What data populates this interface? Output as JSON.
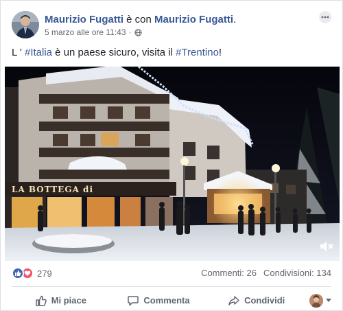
{
  "post": {
    "author": "Maurizio Fugatti",
    "with_text": " è con ",
    "with_person": "Maurizio Fugatti",
    "with_end": ".",
    "timestamp": "5 marzo alle ore 11:43",
    "meta_separator": "·",
    "privacy_icon": "globe-icon",
    "text": {
      "prefix": "L ' ",
      "hashtag1": "#Italia",
      "middle": " è un paese sicuro, visita il ",
      "hashtag2": "#Trentino",
      "suffix": "!"
    },
    "video": {
      "shop_sign": "LA BOTTEGA di",
      "mute_icon": "speaker-muted-icon"
    }
  },
  "stats": {
    "reaction_icons": [
      "like-icon",
      "love-icon"
    ],
    "reactions_count": "279",
    "comments": "Commenti: 26",
    "shares": "Condivisioni: 134"
  },
  "actions": {
    "like": "Mi piace",
    "comment": "Commenta",
    "share": "Condividi"
  },
  "colors": {
    "link": "#385898",
    "like_blue": "#4267b2",
    "love_red": "#f25268",
    "muted_text": "#616770"
  }
}
